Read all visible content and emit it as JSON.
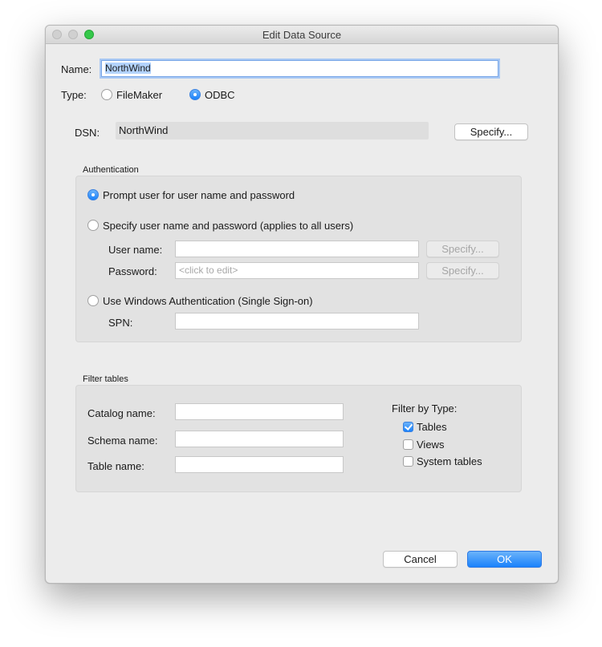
{
  "window": {
    "title": "Edit Data Source"
  },
  "name_row": {
    "label": "Name:",
    "value": "NorthWind"
  },
  "type_row": {
    "label": "Type:",
    "options": [
      {
        "label": "FileMaker",
        "selected": false
      },
      {
        "label": "ODBC",
        "selected": true
      }
    ]
  },
  "dsn_row": {
    "label": "DSN:",
    "value": "NorthWind",
    "specify_label": "Specify..."
  },
  "authentication": {
    "title": "Authentication",
    "prompt_option": "Prompt user for user name and password",
    "specify_option": "Specify user name and password (applies to all users)",
    "username_label": "User name:",
    "username_value": "",
    "username_specify": "Specify...",
    "password_label": "Password:",
    "password_placeholder": "<click to edit>",
    "password_specify": "Specify...",
    "windows_option": "Use Windows Authentication (Single Sign-on)",
    "spn_label": "SPN:",
    "spn_value": "",
    "selected": "prompt"
  },
  "filter_tables": {
    "title": "Filter tables",
    "catalog_label": "Catalog name:",
    "catalog_value": "",
    "schema_label": "Schema name:",
    "schema_value": "",
    "table_label": "Table name:",
    "table_value": "",
    "filter_by_type_label": "Filter by Type:",
    "types": [
      {
        "label": "Tables",
        "checked": true
      },
      {
        "label": "Views",
        "checked": false
      },
      {
        "label": "System tables",
        "checked": false
      }
    ]
  },
  "footer": {
    "cancel_label": "Cancel",
    "ok_label": "OK"
  },
  "colors": {
    "accent": "#1a82fb",
    "focus_ring": "#a9c8f3",
    "selection": "#b3d3fd"
  }
}
